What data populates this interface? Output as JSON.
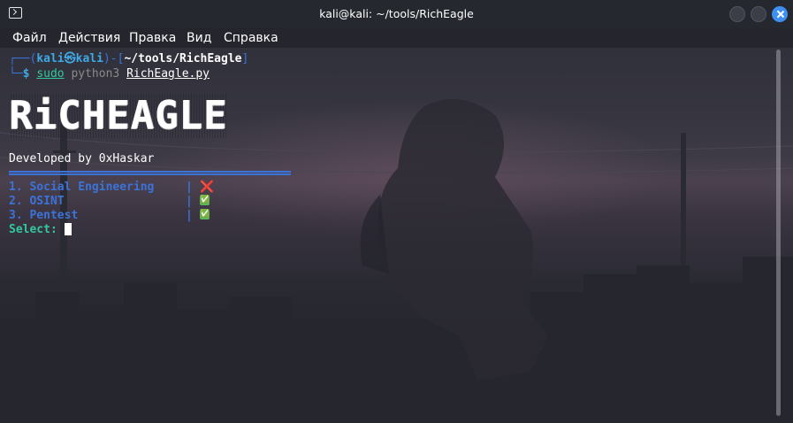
{
  "window": {
    "title": "kali@kali: ~/tools/RichEagle"
  },
  "menu": [
    "Файл",
    "Действия",
    "Правка",
    "Вид",
    "Справка"
  ],
  "prompt": {
    "corner_top": "┌──(",
    "user": "kali",
    "at_symbol": "㉿",
    "host": "kali",
    "mid": ")-[",
    "path": "~/tools/RichEagle",
    "close": "]",
    "corner_bottom": "└─",
    "dollar": "$",
    "cmd_sudo": "sudo",
    "cmd_python": "python3",
    "cmd_file": "RichEagle.py"
  },
  "banner": "RiCHEAGLE",
  "developed_by": "Developed by 0xHaskar",
  "options": [
    {
      "label": "1. Social Engineering",
      "sep": "|",
      "status": "❌"
    },
    {
      "label": "2. OSINT",
      "sep": "|",
      "status": "✅"
    },
    {
      "label": "3. Pentest",
      "sep": "|",
      "status": "✅"
    }
  ],
  "select_prompt": "Select:",
  "colors": {
    "accent_blue": "#3b73d9",
    "prompt_cyan": "#3fa9e6",
    "select_green": "#31c9a0",
    "close_button": "#3d8ff2"
  }
}
